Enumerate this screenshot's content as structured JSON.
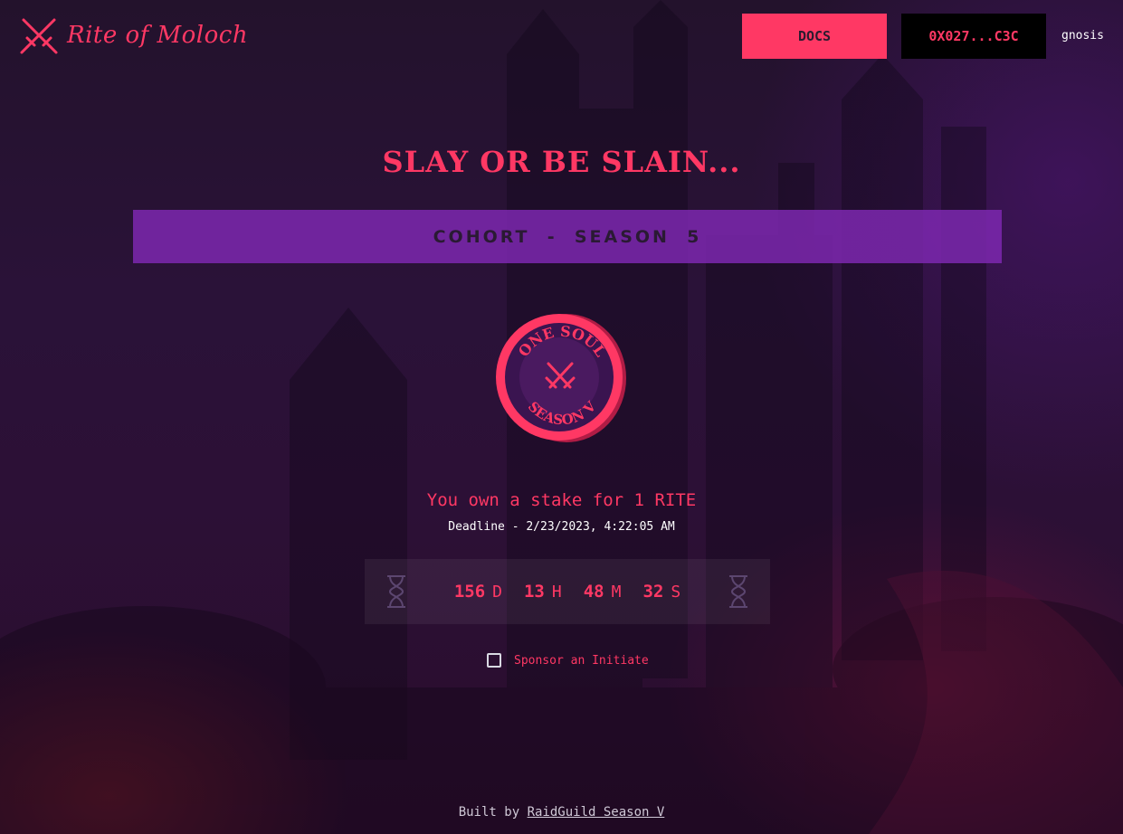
{
  "app": {
    "name": "Rite of Moloch",
    "logo_icon": "crossed-swords-icon"
  },
  "header": {
    "docs_label": "DOCS",
    "wallet_label": "0X027...C3C",
    "network": "gnosis"
  },
  "hero": {
    "title": "SLAY OR BE SLAIN...",
    "cohort_label": "COHORT  -  SEASON  5"
  },
  "coin": {
    "top_text": "ONE SOUL",
    "bottom_text": "SEASON V",
    "icon": "crossed-swords-icon"
  },
  "stake": {
    "text": "You own a stake for 1 RITE",
    "deadline": "Deadline - 2/23/2023, 4:22:05 AM"
  },
  "countdown": {
    "days": "156",
    "days_label": "D",
    "hours": "13",
    "hours_label": "H",
    "minutes": "48",
    "minutes_label": "M",
    "seconds": "32",
    "seconds_label": "S",
    "icon": "hourglass-icon"
  },
  "sponsor": {
    "label": "Sponsor an Initiate",
    "checked": false
  },
  "footer": {
    "prefix": "Built by",
    "link_text": "RaidGuild Season V"
  },
  "colors": {
    "accent": "#ff3864",
    "banner": "#7d28af",
    "wallet_bg": "#000000"
  }
}
